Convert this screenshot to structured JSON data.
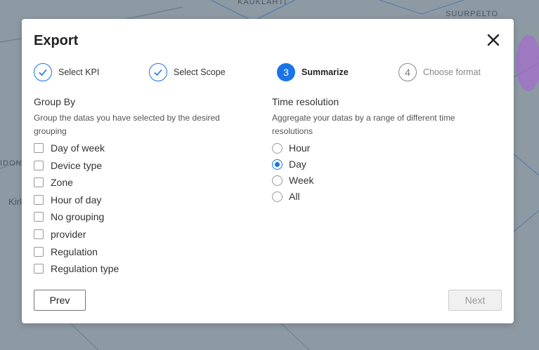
{
  "map": {
    "labels": [
      "KAUKLAHTI",
      "SUURPELTO",
      "IDON",
      "Kirk"
    ]
  },
  "dialog": {
    "title": "Export",
    "close_icon": "close-icon"
  },
  "steps": [
    {
      "number": "1",
      "label": "Select KPI",
      "state": "done"
    },
    {
      "number": "2",
      "label": "Select Scope",
      "state": "done"
    },
    {
      "number": "3",
      "label": "Summarize",
      "state": "active"
    },
    {
      "number": "4",
      "label": "Choose format",
      "state": "todo"
    }
  ],
  "group_by": {
    "title": "Group By",
    "description": "Group the datas you have selected by the desired grouping",
    "options": [
      {
        "label": "Day of week",
        "checked": false
      },
      {
        "label": "Device type",
        "checked": false
      },
      {
        "label": "Zone",
        "checked": false
      },
      {
        "label": "Hour of day",
        "checked": false
      },
      {
        "label": "No grouping",
        "checked": false
      },
      {
        "label": "provider",
        "checked": false
      },
      {
        "label": "Regulation",
        "checked": false
      },
      {
        "label": "Regulation type",
        "checked": false
      }
    ]
  },
  "time_resolution": {
    "title": "Time resolution",
    "description": "Aggregate your datas by a range of different time resolutions",
    "options": [
      {
        "label": "Hour",
        "selected": false
      },
      {
        "label": "Day",
        "selected": true
      },
      {
        "label": "Week",
        "selected": false
      },
      {
        "label": "All",
        "selected": false
      }
    ]
  },
  "footer": {
    "prev_label": "Prev",
    "next_label": "Next"
  },
  "colors": {
    "accent": "#1a73e8",
    "map_background": "#8e9aa3"
  }
}
